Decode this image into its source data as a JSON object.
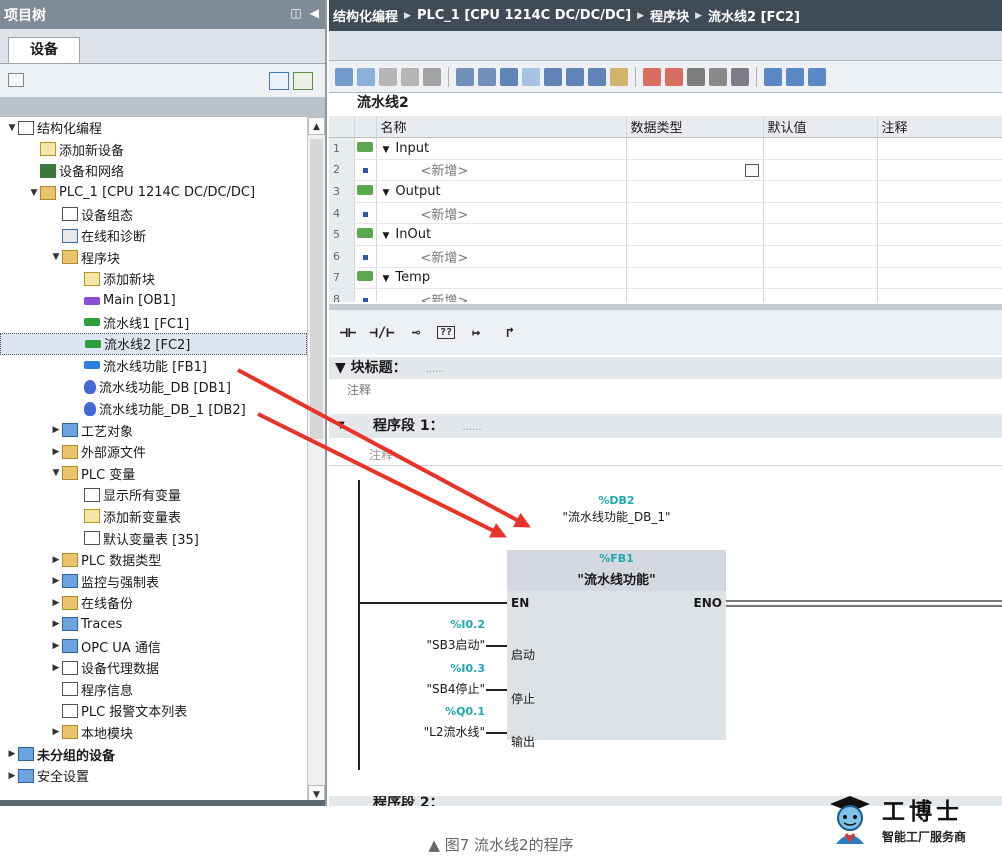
{
  "left_panel": {
    "title": "项目树",
    "tab": "设备",
    "tree": [
      {
        "label": "结构化编程",
        "toggle": "▼",
        "indent": 0,
        "icon": "project-icon"
      },
      {
        "label": "添加新设备",
        "toggle": "",
        "indent": 1,
        "icon": "add-device-icon"
      },
      {
        "label": "设备和网络",
        "toggle": "",
        "indent": 1,
        "icon": "network-icon"
      },
      {
        "label": "PLC_1 [CPU 1214C DC/DC/DC]",
        "toggle": "▼",
        "indent": 1,
        "icon": "plc-icon"
      },
      {
        "label": "设备组态",
        "toggle": "",
        "indent": 2,
        "icon": "device-config-icon"
      },
      {
        "label": "在线和诊断",
        "toggle": "",
        "indent": 2,
        "icon": "diagnostics-icon"
      },
      {
        "label": "程序块",
        "toggle": "▼",
        "indent": 2,
        "icon": "program-blocks-icon"
      },
      {
        "label": "添加新块",
        "toggle": "",
        "indent": 3,
        "icon": "add-block-icon"
      },
      {
        "label": "Main [OB1]",
        "toggle": "",
        "indent": 3,
        "icon": "ob-icon"
      },
      {
        "label": "流水线1 [FC1]",
        "toggle": "",
        "indent": 3,
        "icon": "fc-icon"
      },
      {
        "label": "流水线2 [FC2]",
        "toggle": "",
        "indent": 3,
        "icon": "fc-icon",
        "selected": true
      },
      {
        "label": "流水线功能 [FB1]",
        "toggle": "",
        "indent": 3,
        "icon": "fb-icon"
      },
      {
        "label": "流水线功能_DB [DB1]",
        "toggle": "",
        "indent": 3,
        "icon": "db-icon"
      },
      {
        "label": "流水线功能_DB_1 [DB2]",
        "toggle": "",
        "indent": 3,
        "icon": "db-icon"
      },
      {
        "label": "工艺对象",
        "toggle": "▶",
        "indent": 2,
        "icon": "tech-objects-icon"
      },
      {
        "label": "外部源文件",
        "toggle": "▶",
        "indent": 2,
        "icon": "source-files-icon"
      },
      {
        "label": "PLC 变量",
        "toggle": "▼",
        "indent": 2,
        "icon": "plc-tags-icon"
      },
      {
        "label": "显示所有变量",
        "toggle": "",
        "indent": 3,
        "icon": "show-tags-icon"
      },
      {
        "label": "添加新变量表",
        "toggle": "",
        "indent": 3,
        "icon": "add-tag-table-icon"
      },
      {
        "label": "默认变量表 [35]",
        "toggle": "",
        "indent": 3,
        "icon": "tag-table-icon"
      },
      {
        "label": "PLC 数据类型",
        "toggle": "▶",
        "indent": 2,
        "icon": "data-types-icon"
      },
      {
        "label": "监控与强制表",
        "toggle": "▶",
        "indent": 2,
        "icon": "watch-table-icon"
      },
      {
        "label": "在线备份",
        "toggle": "▶",
        "indent": 2,
        "icon": "backup-icon"
      },
      {
        "label": "Traces",
        "toggle": "▶",
        "indent": 2,
        "icon": "traces-icon"
      },
      {
        "label": "OPC UA 通信",
        "toggle": "▶",
        "indent": 2,
        "icon": "opcua-icon"
      },
      {
        "label": "设备代理数据",
        "toggle": "▶",
        "indent": 2,
        "icon": "proxy-data-icon"
      },
      {
        "label": "程序信息",
        "toggle": "",
        "indent": 2,
        "icon": "program-info-icon"
      },
      {
        "label": "PLC 报警文本列表",
        "toggle": "",
        "indent": 2,
        "icon": "alarm-text-icon"
      },
      {
        "label": "本地模块",
        "toggle": "▶",
        "indent": 2,
        "icon": "local-modules-icon"
      },
      {
        "label": "未分组的设备",
        "toggle": "▶",
        "indent": 0,
        "icon": "ungrouped-devices-icon",
        "bold": true
      },
      {
        "label": "安全设置",
        "toggle": "▶",
        "indent": 0,
        "icon": "security-icon"
      }
    ]
  },
  "editor": {
    "breadcrumb": [
      "结构化编程",
      "PLC_1 [CPU 1214C DC/DC/DC]",
      "程序块",
      "流水线2 [FC2]"
    ],
    "block_name": "流水线2",
    "interface": {
      "columns": [
        "名称",
        "数据类型",
        "默认值",
        "注释"
      ],
      "rows": [
        {
          "num": "1",
          "kind": "section",
          "name": "Input"
        },
        {
          "num": "2",
          "kind": "add",
          "name": "<新增>"
        },
        {
          "num": "3",
          "kind": "section",
          "name": "Output"
        },
        {
          "num": "4",
          "kind": "add",
          "name": "<新增>"
        },
        {
          "num": "5",
          "kind": "section",
          "name": "InOut"
        },
        {
          "num": "6",
          "kind": "add",
          "name": "<新增>"
        },
        {
          "num": "7",
          "kind": "section",
          "name": "Temp"
        },
        {
          "num": "8",
          "kind": "add",
          "name": "<新增>"
        }
      ]
    },
    "ladder_toolbar": [
      "⊣⊢",
      "⊣/⊢",
      "⊸",
      "??",
      "↦",
      "↱"
    ],
    "block_title_label": "▼ 块标题：",
    "block_title_dots": "......",
    "block_comment": "注释",
    "segment1_label": "程序段 1：",
    "segment1_comment": "注释",
    "fb_call": {
      "instance_addr": "%DB2",
      "instance_name": "\"流水线功能_DB_1\"",
      "fb_addr": "%FB1",
      "fb_name": "\"流水线功能\"",
      "en": "EN",
      "eno": "ENO",
      "inputs": [
        {
          "addr": "%I0.2",
          "tag": "\"SB3启动\"",
          "pin": "启动"
        },
        {
          "addr": "%I0.3",
          "tag": "\"SB4停止\"",
          "pin": "停止"
        },
        {
          "addr": "%Q0.1",
          "tag": "\"L2流水线\"",
          "pin": "输出"
        }
      ]
    },
    "segment2_label": "程序段 2："
  },
  "caption": "▲ 图7 流水线2的程序",
  "logo": {
    "title": "工博士",
    "subtitle": "智能工厂服务商"
  },
  "colors": {
    "accent_teal": "#20a8b0",
    "arrow_red": "#e8322a",
    "titlebar": "#3f4c57"
  }
}
